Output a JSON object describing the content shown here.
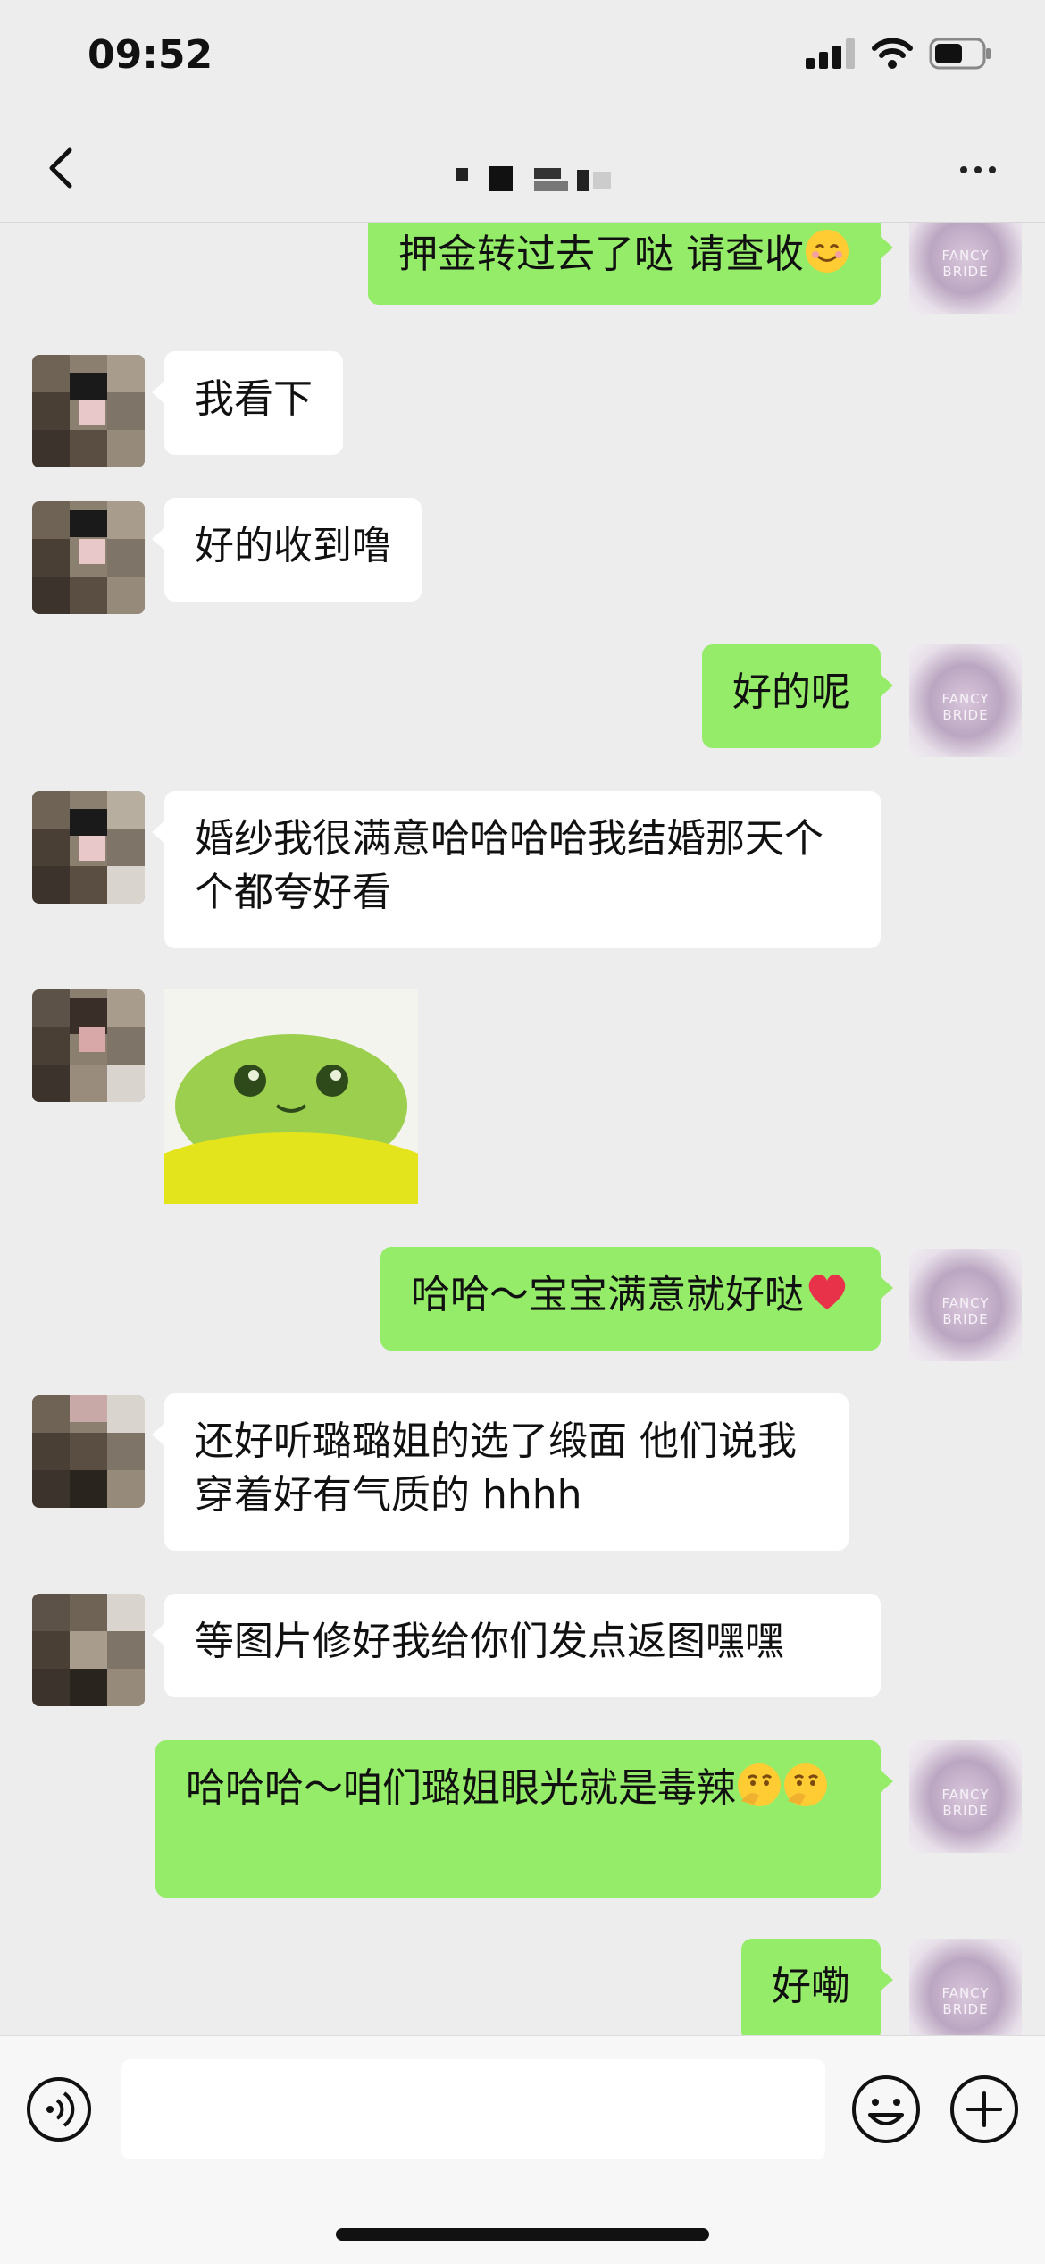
{
  "status_bar": {
    "time": "09:52"
  },
  "header": {
    "back_icon": "chevron-left-icon",
    "more_icon": "ellipsis-icon"
  },
  "messages": [
    {
      "side": "me",
      "text": "押金转过去了哒 请查收",
      "emoji": "smiling-face"
    },
    {
      "side": "them",
      "text": "我看下"
    },
    {
      "side": "them",
      "text": "好的收到噜"
    },
    {
      "side": "me",
      "text": "好的呢"
    },
    {
      "side": "them",
      "text": "婚纱我很满意哈哈哈哈我结婚那天个个都夸好看"
    },
    {
      "side": "them",
      "type": "sticker",
      "sticker": "green-frog-sticker"
    },
    {
      "side": "me",
      "text": "哈哈～宝宝满意就好哒",
      "emoji": "red-heart"
    },
    {
      "side": "them",
      "text": "还好听璐璐姐的选了缎面 他们说我穿着好有气质的 hhhh"
    },
    {
      "side": "them",
      "text": "等图片修好我给你们发点返图嘿嘿"
    },
    {
      "side": "me",
      "text": "哈哈哈～咱们璐姐眼光就是毒辣",
      "emoji": "thinking-face"
    },
    {
      "side": "me",
      "text": "好嘞"
    }
  ],
  "avatar_brand": "FANCY BRIDE",
  "input_bar": {
    "placeholder": "",
    "icons": [
      "voice-icon",
      "emoji-icon",
      "plus-icon"
    ]
  },
  "colors": {
    "background": "#ededed",
    "my_bubble": "#95ec69",
    "their_bubble": "#ffffff"
  }
}
